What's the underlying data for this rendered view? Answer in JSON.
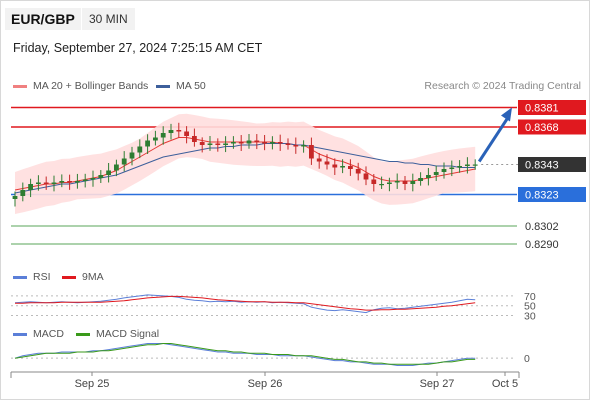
{
  "header": {
    "symbol": "EUR/GBP",
    "timeframe": "30 MIN",
    "datetime": "Friday, September 27, 2024 7:25:15 AM CET",
    "credit": "Research © 2024 Trading Central"
  },
  "legend": {
    "ma20": "MA 20 + Bollinger Bands",
    "ma50": "MA 50",
    "rsi": "RSI",
    "ma9": "9MA",
    "macd": "MACD",
    "macd_signal": "MACD Signal"
  },
  "colors": {
    "candle_up": "#2e7d32",
    "candle_down": "#c62828",
    "ma20": "#e53935",
    "bollinger_fill": "#ffdede",
    "ma50": "#3d5f9b",
    "resistance": "#e0191f",
    "pivot": "#2a6fdb",
    "support": "#5aa55a",
    "last_price": "#333333",
    "rsi": "#5b7fd8",
    "rsi_ma": "#e0191f",
    "macd": "#5b7fd8",
    "macd_signal": "#3a9a1a",
    "arrow": "#2a62b8"
  },
  "chart_data": [
    {
      "type": "candlestick",
      "panel": "price",
      "x_ticks": [
        "Sep 25",
        "Sep 26",
        "Sep 27",
        "Oct 5"
      ],
      "ylim": [
        0.8282,
        0.8386
      ],
      "grid": false,
      "candles": {
        "interval": "30 MIN",
        "close": [
          0.8322,
          0.8326,
          0.833,
          0.8331,
          0.833,
          0.8331,
          0.8332,
          0.8331,
          0.8332,
          0.8333,
          0.8334,
          0.8336,
          0.8339,
          0.8343,
          0.8347,
          0.8351,
          0.8355,
          0.8359,
          0.8361,
          0.8364,
          0.8366,
          0.8365,
          0.8362,
          0.8358,
          0.8356,
          0.8357,
          0.8356,
          0.8357,
          0.8358,
          0.8357,
          0.8359,
          0.8358,
          0.8357,
          0.8358,
          0.8357,
          0.8356,
          0.8355,
          0.8356,
          0.8347,
          0.8345,
          0.8343,
          0.8341,
          0.8342,
          0.834,
          0.8337,
          0.8333,
          0.833,
          0.833,
          0.8331,
          0.8332,
          0.833,
          0.8332,
          0.8334,
          0.8336,
          0.8338,
          0.834,
          0.8341,
          0.8342,
          0.8343,
          0.8343
        ]
      },
      "ma20": [
        0.8326,
        0.8327,
        0.8328,
        0.8329,
        0.833,
        0.833,
        0.8331,
        0.8331,
        0.8332,
        0.8333,
        0.8334,
        0.8335,
        0.8337,
        0.8339,
        0.8342,
        0.8345,
        0.8348,
        0.8351,
        0.8354,
        0.8357,
        0.8359,
        0.8361,
        0.8361,
        0.836,
        0.8359,
        0.8358,
        0.8358,
        0.8358,
        0.8358,
        0.8358,
        0.8358,
        0.8358,
        0.8358,
        0.8358,
        0.8357,
        0.8357,
        0.8356,
        0.8356,
        0.8353,
        0.835,
        0.8348,
        0.8346,
        0.8345,
        0.8343,
        0.8341,
        0.8338,
        0.8335,
        0.8333,
        0.8332,
        0.8332,
        0.8332,
        0.8332,
        0.8333,
        0.8334,
        0.8335,
        0.8336,
        0.8337,
        0.8338,
        0.8339,
        0.834
      ],
      "ma50": [
        0.8324,
        0.8325,
        0.8326,
        0.8327,
        0.8328,
        0.8329,
        0.833,
        0.833,
        0.8331,
        0.8332,
        0.8333,
        0.8334,
        0.8335,
        0.8336,
        0.8338,
        0.834,
        0.8342,
        0.8344,
        0.8346,
        0.8348,
        0.8349,
        0.835,
        0.8351,
        0.8352,
        0.8353,
        0.8354,
        0.8354,
        0.8355,
        0.8355,
        0.8356,
        0.8356,
        0.8356,
        0.8357,
        0.8357,
        0.8357,
        0.8357,
        0.8356,
        0.8356,
        0.8355,
        0.8354,
        0.8353,
        0.8352,
        0.8351,
        0.835,
        0.8349,
        0.8348,
        0.8347,
        0.8346,
        0.8345,
        0.8345,
        0.8344,
        0.8344,
        0.8343,
        0.8343,
        0.8342,
        0.8342,
        0.8342,
        0.8341,
        0.8341,
        0.8341
      ],
      "levels": [
        {
          "value": 0.8381,
          "label": "0.8381",
          "kind": "resistance"
        },
        {
          "value": 0.8368,
          "label": "0.8368",
          "kind": "resistance"
        },
        {
          "value": 0.8343,
          "label": "0.8343",
          "kind": "last_price"
        },
        {
          "value": 0.8323,
          "label": "0.8323",
          "kind": "pivot"
        },
        {
          "value": 0.8302,
          "label": "0.8302",
          "kind": "support"
        },
        {
          "value": 0.829,
          "label": "0.8290",
          "kind": "support"
        }
      ],
      "arrow": {
        "from": 0.8343,
        "to": 0.8381,
        "direction": "up"
      }
    },
    {
      "type": "line",
      "panel": "rsi",
      "ticks": [
        "70",
        "50",
        "30"
      ],
      "ylim": [
        25,
        80
      ],
      "series": [
        {
          "name": "RSI",
          "values": [
            56,
            57,
            58,
            57,
            56,
            57,
            58,
            57,
            56,
            57,
            58,
            59,
            61,
            63,
            66,
            68,
            70,
            72,
            71,
            70,
            69,
            67,
            63,
            61,
            60,
            58,
            59,
            58,
            59,
            57,
            58,
            57,
            58,
            56,
            57,
            56,
            55,
            54,
            47,
            44,
            41,
            40,
            42,
            40,
            38,
            36,
            42,
            45,
            46,
            44,
            45,
            47,
            49,
            51,
            53,
            55,
            57,
            60,
            63,
            62
          ]
        },
        {
          "name": "9MA",
          "values": [
            55,
            55,
            56,
            56,
            56,
            56,
            57,
            57,
            57,
            57,
            57,
            57,
            58,
            59,
            60,
            62,
            64,
            66,
            67,
            68,
            69,
            69,
            68,
            67,
            66,
            64,
            62,
            61,
            60,
            59,
            58,
            58,
            58,
            57,
            57,
            57,
            56,
            56,
            54,
            52,
            50,
            48,
            46,
            44,
            43,
            41,
            41,
            42,
            42,
            43,
            43,
            44,
            45,
            46,
            47,
            49,
            50,
            52,
            54,
            56
          ]
        }
      ]
    },
    {
      "type": "line",
      "panel": "macd",
      "ticks": [
        "0"
      ],
      "ylim": [
        -0.0008,
        0.0014
      ],
      "series": [
        {
          "name": "MACD",
          "values": [
            0.0,
            0.0002,
            0.0003,
            0.0004,
            0.0004,
            0.0004,
            0.0005,
            0.0005,
            0.0005,
            0.0005,
            0.0006,
            0.0006,
            0.0007,
            0.0008,
            0.0009,
            0.001,
            0.0011,
            0.0012,
            0.0012,
            0.0012,
            0.0011,
            0.001,
            0.0009,
            0.0008,
            0.0007,
            0.0006,
            0.0005,
            0.0005,
            0.0004,
            0.0004,
            0.0004,
            0.0003,
            0.0003,
            0.0003,
            0.0002,
            0.0002,
            0.0002,
            0.0002,
            0.0001,
            0.0,
            -0.0001,
            -0.0002,
            -0.0002,
            -0.0003,
            -0.0003,
            -0.0004,
            -0.0005,
            -0.0005,
            -0.0005,
            -0.0006,
            -0.0006,
            -0.0006,
            -0.0005,
            -0.0004,
            -0.0004,
            -0.0003,
            -0.0002,
            -0.0001,
            0.0,
            0.0
          ]
        },
        {
          "name": "MACD Signal",
          "values": [
            0.0,
            0.0001,
            0.0002,
            0.0003,
            0.0004,
            0.0004,
            0.0004,
            0.0004,
            0.0005,
            0.0005,
            0.0005,
            0.0006,
            0.0006,
            0.0007,
            0.0008,
            0.0009,
            0.001,
            0.0011,
            0.0011,
            0.0012,
            0.0012,
            0.0011,
            0.001,
            0.0009,
            0.0008,
            0.0007,
            0.0006,
            0.0006,
            0.0005,
            0.0005,
            0.0004,
            0.0004,
            0.0004,
            0.0003,
            0.0003,
            0.0003,
            0.0002,
            0.0002,
            0.0002,
            0.0001,
            0.0,
            -0.0001,
            -0.0001,
            -0.0002,
            -0.0003,
            -0.0003,
            -0.0004,
            -0.0004,
            -0.0005,
            -0.0005,
            -0.0005,
            -0.0005,
            -0.0005,
            -0.0005,
            -0.0004,
            -0.0003,
            -0.0003,
            -0.0002,
            -0.0001,
            -0.0001
          ]
        }
      ]
    }
  ]
}
